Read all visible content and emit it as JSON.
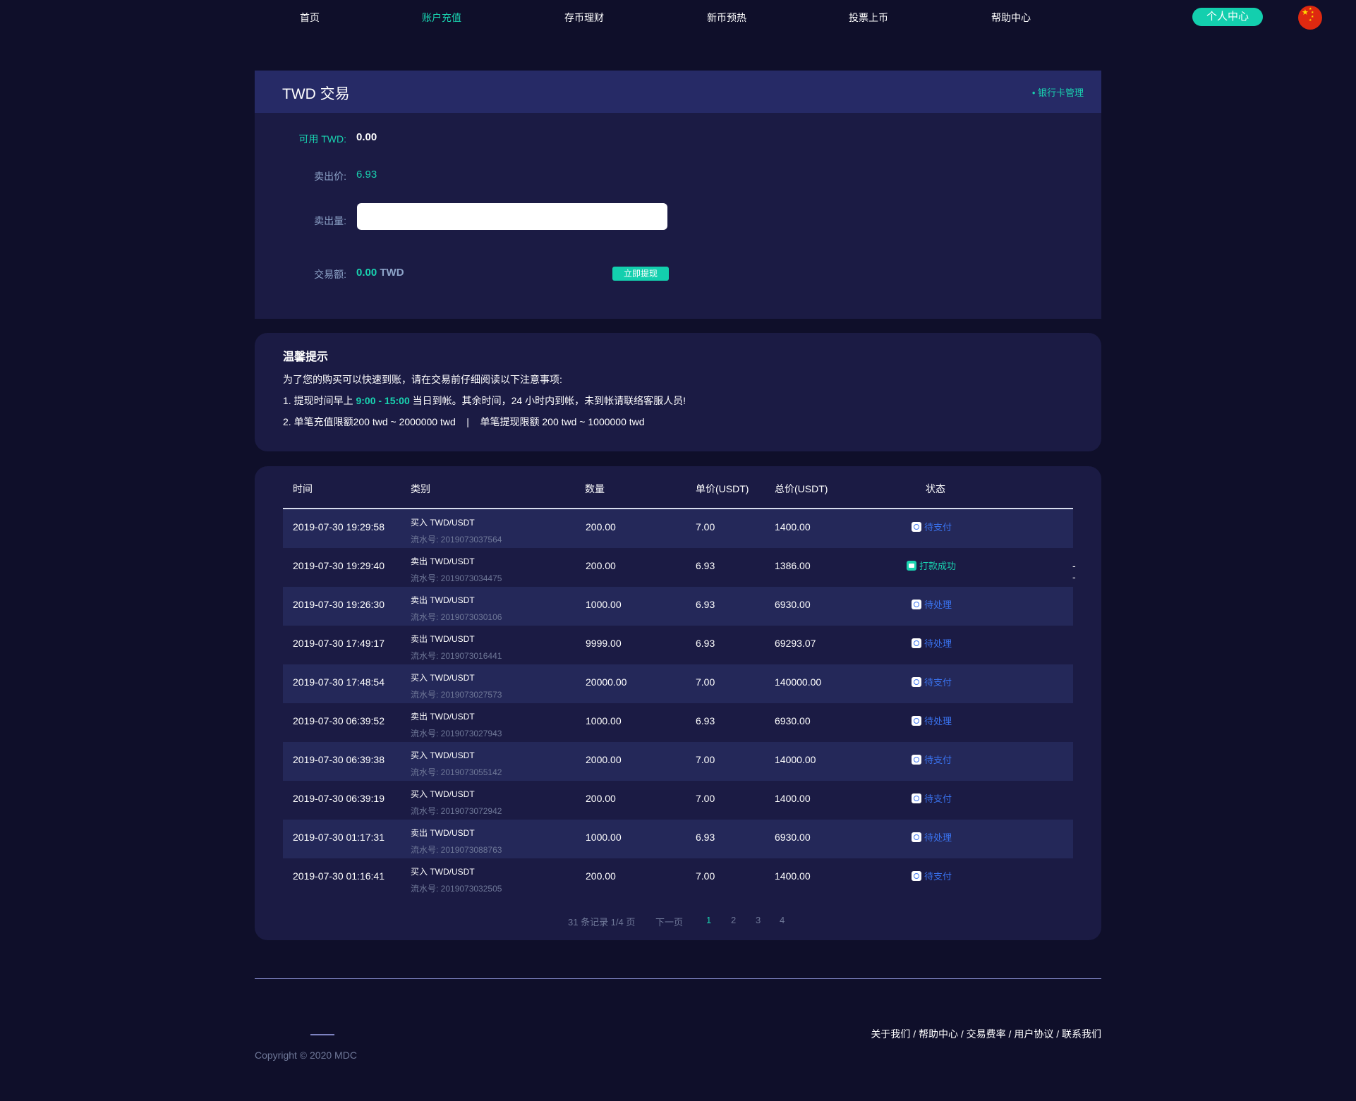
{
  "nav": {
    "items": [
      {
        "label": "首页"
      },
      {
        "label": "账户充值"
      },
      {
        "label": "存币理财"
      },
      {
        "label": "新币预热"
      },
      {
        "label": "投票上币"
      },
      {
        "label": "帮助中心"
      }
    ],
    "active_index": 1,
    "user_button": "个人中心",
    "flag_icon": "china-flag-icon"
  },
  "trade": {
    "title": "TWD 交易",
    "bank_link": "• 银行卡管理",
    "available_label": "可用 TWD:",
    "available_value": "0.00",
    "price_label": "卖出价:",
    "price_value": "6.93",
    "amount_label": "卖出量:",
    "amount_value": "",
    "amount_placeholder": "",
    "total_label": "交易额:",
    "total_value": "0.00",
    "total_currency": "TWD",
    "withdraw_button": "立即提现"
  },
  "tips": {
    "title": "温馨提示",
    "intro": "为了您的购买可以快速到账，请在交易前仔细阅读以下注意事项:",
    "line1_pre": "1. 提现时间早上 ",
    "line1_time": "9:00 - 15:00",
    "line1_post": " 当日到帐。其余时间，24 小时内到帐，未到帐请联络客服人员!",
    "line2": "2. 单笔充值限额200 twd ~ 2000000 twd    |    单笔提现限额 200 twd ~ 1000000 twd"
  },
  "table": {
    "headers": [
      "时间",
      "类别",
      "数量",
      "单价(USDT)",
      "总价(USDT)",
      "状态"
    ],
    "rows": [
      {
        "time": "2019-07-30 19:29:58",
        "type": "买入 TWD/USDT",
        "serial": "流水号: 2019073037564",
        "qty": "200.00",
        "price": "7.00",
        "total": "1400.00",
        "status": "待支付",
        "status_kind": "pending",
        "extra": ""
      },
      {
        "time": "2019-07-30 19:29:40",
        "type": "卖出 TWD/USDT",
        "serial": "流水号: 2019073034475",
        "qty": "200.00",
        "price": "6.93",
        "total": "1386.00",
        "status": "打款成功",
        "status_kind": "done",
        "extra": "--"
      },
      {
        "time": "2019-07-30 19:26:30",
        "type": "卖出 TWD/USDT",
        "serial": "流水号: 2019073030106",
        "qty": "1000.00",
        "price": "6.93",
        "total": "6930.00",
        "status": "待处理",
        "status_kind": "pending",
        "extra": ""
      },
      {
        "time": "2019-07-30 17:49:17",
        "type": "卖出 TWD/USDT",
        "serial": "流水号: 2019073016441",
        "qty": "9999.00",
        "price": "6.93",
        "total": "69293.07",
        "status": "待处理",
        "status_kind": "pending",
        "extra": ""
      },
      {
        "time": "2019-07-30 17:48:54",
        "type": "买入 TWD/USDT",
        "serial": "流水号: 2019073027573",
        "qty": "20000.00",
        "price": "7.00",
        "total": "140000.00",
        "status": "待支付",
        "status_kind": "pending",
        "extra": ""
      },
      {
        "time": "2019-07-30 06:39:52",
        "type": "卖出 TWD/USDT",
        "serial": "流水号: 2019073027943",
        "qty": "1000.00",
        "price": "6.93",
        "total": "6930.00",
        "status": "待处理",
        "status_kind": "pending",
        "extra": ""
      },
      {
        "time": "2019-07-30 06:39:38",
        "type": "买入 TWD/USDT",
        "serial": "流水号: 2019073055142",
        "qty": "2000.00",
        "price": "7.00",
        "total": "14000.00",
        "status": "待支付",
        "status_kind": "pending",
        "extra": ""
      },
      {
        "time": "2019-07-30 06:39:19",
        "type": "买入 TWD/USDT",
        "serial": "流水号: 2019073072942",
        "qty": "200.00",
        "price": "7.00",
        "total": "1400.00",
        "status": "待支付",
        "status_kind": "pending",
        "extra": ""
      },
      {
        "time": "2019-07-30 01:17:31",
        "type": "卖出 TWD/USDT",
        "serial": "流水号: 2019073088763",
        "qty": "1000.00",
        "price": "6.93",
        "total": "6930.00",
        "status": "待处理",
        "status_kind": "pending",
        "extra": ""
      },
      {
        "time": "2019-07-30 01:16:41",
        "type": "买入 TWD/USDT",
        "serial": "流水号: 2019073032505",
        "qty": "200.00",
        "price": "7.00",
        "total": "1400.00",
        "status": "待支付",
        "status_kind": "pending",
        "extra": ""
      }
    ]
  },
  "pagination": {
    "summary": "31 条记录 1/4 页",
    "next": "下一页",
    "pages": [
      "1",
      "2",
      "3",
      "4"
    ],
    "current": "1"
  },
  "footer": {
    "links": [
      "关于我们",
      "帮助中心",
      "交易费率",
      "用户协议",
      "联系我们"
    ],
    "separator": " / ",
    "copyright": "Copyright © 2020 MDC"
  },
  "colors": {
    "background": "#0f0f2a",
    "panel": "#1b1b44",
    "accent": "#19d3b0",
    "pending_status": "#3a73f0"
  }
}
